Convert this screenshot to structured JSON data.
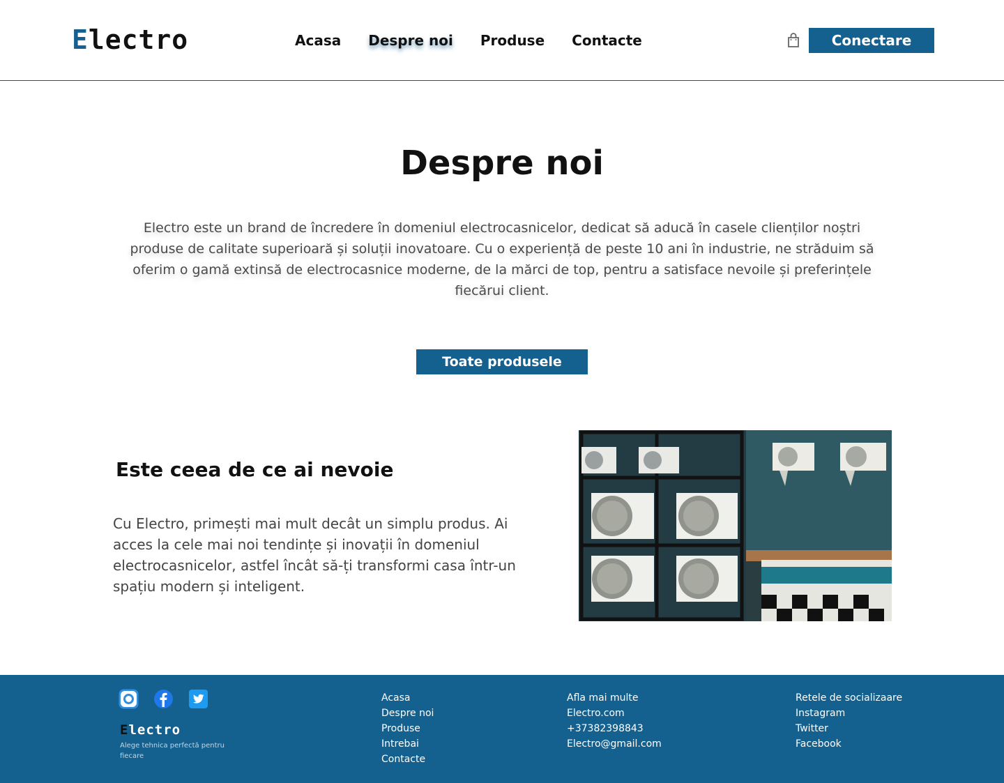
{
  "header": {
    "logo_first": "E",
    "logo_rest": "lectro",
    "nav": [
      {
        "label": "Acasa"
      },
      {
        "label": "Despre noi"
      },
      {
        "label": "Produse"
      },
      {
        "label": "Contacte"
      }
    ],
    "login_label": "Conectare"
  },
  "hero": {
    "title": "Despre noi",
    "text": "Electro este un brand de încredere în domeniul electrocasnicelor, dedicat să aducă în casele clienților noștri produse de calitate superioară și soluții inovatoare. Cu o experiență de peste 10 ani în industrie, ne străduim să oferim o gamă extinsă de electrocasnice moderne, de la mărci de top, pentru a satisface nevoile și preferințele fiecărui client.",
    "button_label": "Toate produsele"
  },
  "feature": {
    "title": "Este ceea de ce ai nevoie",
    "text": "Cu Electro, primești mai mult decât un simplu produs. Ai acces la cele mai noi tendințe și inovații în domeniul electrocasnicelor, astfel încât să-ți transformi casa într-un spațiu modern și inteligent."
  },
  "footer": {
    "logo_first": "E",
    "logo_rest": "lectro",
    "tagline": "Alege tehnica perfectă pentru fiecare",
    "nav_links": [
      "Acasa",
      "Despre noi",
      "Produse",
      "Intrebai",
      "Contacte"
    ],
    "info": [
      "Afla mai multe",
      "Electro.com",
      "+37382398843",
      "Electro@gmail.com"
    ],
    "social_links": [
      "Retele de socializaare",
      "Instagram",
      "Twitter",
      "Facebook"
    ]
  },
  "colors": {
    "brand": "#14608f",
    "text_dark": "#111111",
    "text_body": "#4a4a4a"
  },
  "icons": [
    "cart-icon",
    "instagram-icon",
    "facebook-icon",
    "twitter-icon"
  ]
}
